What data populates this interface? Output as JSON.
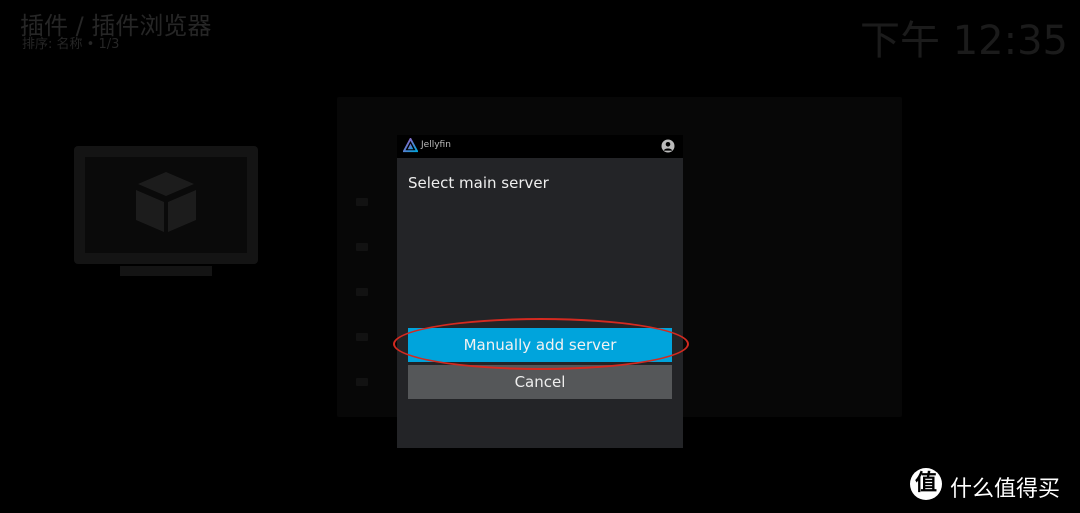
{
  "background": {
    "header_title": "插件 / 插件浏览器",
    "header_subtitle": "排序: 名称 • 1/3",
    "clock": "下午 12:35"
  },
  "dialog": {
    "app_name": "Jellyfin",
    "title": "Select main server",
    "add_server_label": "Manually add server",
    "cancel_label": "Cancel"
  },
  "watermark": {
    "badge": "值",
    "text": "什么值得买"
  },
  "colors": {
    "accent": "#00a4dc",
    "highlight_ring": "#d42a20",
    "dialog_bg": "#232427",
    "cancel_bg": "#555759"
  }
}
